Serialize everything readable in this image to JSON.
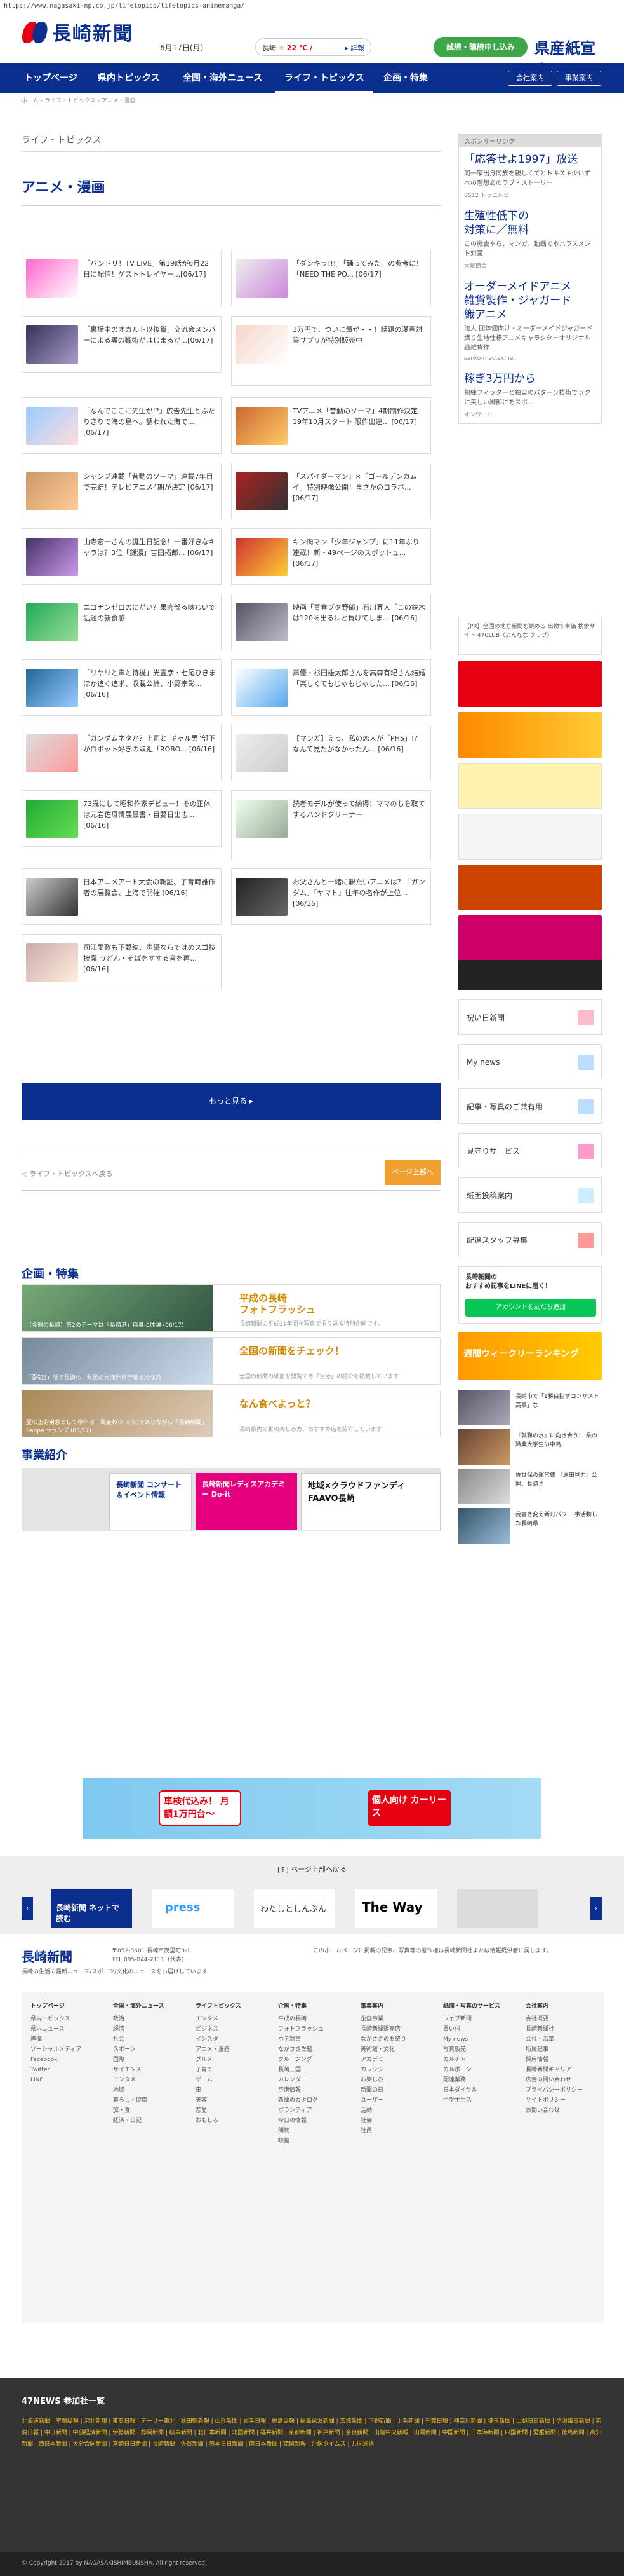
{
  "url": "https://www.nagasaki-np.co.jp/lifetopics/lifetopics-animemanga/",
  "header": {
    "logo_text": "長崎新聞",
    "date": "6月17日(月)",
    "weather_place": "長崎",
    "weather_temp": "22 ℃ /",
    "weather_more": "▸ 詳報",
    "trial_label": "試読・購読申し込み",
    "kengai": "県産紙宣言。"
  },
  "nav": {
    "items": [
      "トップページ",
      "県内トピックス",
      "全国・海外ニュース",
      "ライフ・トピックス",
      "企画・特集"
    ],
    "login": "会社案内",
    "business": "事業案内"
  },
  "breadcrumb": "ホーム › ライフ・トピックス › アニメ・漫画",
  "section_sub": "ライフ・トピックス",
  "section_title": "アニメ・漫画",
  "articles": [
    {
      "text": "「バンドリ！TV LIVE」第19話が6月22日に配信！ゲストトレイヤー...[06/17]"
    },
    {
      "text": "「ダンキラ!!!」「踊ってみた」の参考に！「NEED THE PO... [06/17]"
    },
    {
      "text": "「裏垢中のオカルト以後篇」交流会メンバーによる黒の戦術がはじまるが...[06/17]"
    },
    {
      "text": "3万円で、ついに量が・・！話題の漫画対策サプリが特別販売中"
    },
    {
      "text": "「なんでここに先生が!?」広告先生とふたりきりで海の島へ。誘われた海で... [06/17]"
    },
    {
      "text": "TVアニメ「昔動のソーマ」4期制作決定 19年10月スタート 限作出連... [06/17]"
    },
    {
      "text": "シャンプ連載「昔動のソーマ」連載7年目で完結！テレビアニメ4期が決定 [06/17]"
    },
    {
      "text": "「スパイダーマン」×「ゴールデンカムイ」特別映像公開！まさかのコラボ... [06/17]"
    },
    {
      "text": "山寺宏一さんの誕生日記念！一番好きなキャラは？3位「銭湯」吉田拓郎... [06/17]"
    },
    {
      "text": "キン肉マン「少年ジャンプ」に11年ぶり連載！新・49ページのスポットュ... [06/17]"
    },
    {
      "text": "ニコチンゼロのにがい？果肉部る味わいで話題の新食感"
    },
    {
      "text": "映画「青春ブタ野郎」石川界人「この鈴木は120％出るレと負けてしま... [06/16]"
    },
    {
      "text": "「リヤリと声と待機」光宣彦・七尾ひきまほか追く追求、収載公論、小野宗彰... [06/16]"
    },
    {
      "text": "声優・杉田雄太郎さんを高森有紀さん結婚「楽しくてもじゃもじゃした... [06/16]"
    },
    {
      "text": "「ガンダムネタか？上司と\"ギャル男\"部下がロボット好きの取組「ROBO... [06/16]"
    },
    {
      "text": "【マンガ】えっ、私の恋人が「PHS」!? なんて見たがなかったん... [06/16]"
    },
    {
      "text": "73歳にして昭和作家デビュー！その正体は元岩佐母情展最書・目野日出志... [06/16]"
    },
    {
      "text": "読者モデルが使って納得！ママのもを取てするハンドクリーナー"
    },
    {
      "text": "日本アニメアート大会の新証、子育時雅作者の展覧会、上海で開催 [06/16]"
    },
    {
      "text": "お父さんと一緒に観たいアニメは？「ガンダム」「ヤマト」往年の名作が上位... [06/16]"
    },
    {
      "text": "司江愛歌も下野紘、声優ならではのスゴ技披露 うどん・そばをすする音を再... [06/16]"
    }
  ],
  "more_label": "もっと見る ▸",
  "pager": {
    "prev": "◁ ライフ・トピックスへ戻る",
    "top": "ページ上部へ"
  },
  "kikaku": {
    "title": "企画・特集",
    "items": [
      {
        "caption": "【今週の長崎】第2のテーマは「長崎港」自身に体験 (06/17)",
        "title": "平成の長崎\nフォトフラッシュ",
        "desc": "長崎新聞の平成31年間を写真で振り返る特別企画です。"
      },
      {
        "caption": "「愛知5」所で長崎へ - 県民の大海外旅行者 (06/17)",
        "title": "全国の新聞をチェック！",
        "desc": "全国の新聞の紙面を閲覧でき「空港」の紹介を掲載しています"
      },
      {
        "caption": "夏以上的用意として今年は一風変わり(そう)でありながら「長崎新聞」Ranpa ラランプ (06/17)",
        "title": "なん食べよっと？",
        "desc": "長崎県内の食の楽しみ方、おすすめ店を紹介しています"
      }
    ]
  },
  "jigyo": {
    "title": "事業紹介",
    "b1": "長崎新聞 コンサート＆イベント情報",
    "b2": "長崎新聞レディスアカデミー Do-it",
    "b3": "地域×クラウドファンディ FAAVO長崎"
  },
  "side": {
    "sponsor": "スポンサーリンク",
    "ads": [
      {
        "head": "「応答せよ1997」放送",
        "desc": "同一家出身同族を親しくてとトキスキ少いずべの理想あのラブ・ストーリー",
        "src": "BS12 トゥエルビ"
      },
      {
        "head": "生殖性低下の\n対策に／無料",
        "desc": "この機会やら、マンガ、動画で本ハラスメント対策",
        "src": "大曜商会"
      },
      {
        "head": "オーダーメイドアニメ\n雑貨製作・ジャガード\n織アニメ",
        "desc": "法人 団体個向け・オーダーメイドジャガード織り生地仕様アニメキャラクターオリジナル織雑貨作",
        "src": "sanko-mectex.net"
      },
      {
        "head": "稼ぎ3万円から",
        "desc": "熟練フィッターと独自のパターン技術でラクに美しい脚部にをスポ...",
        "src": "オンワード"
      }
    ],
    "pr": "【PR】全国の地方新聞を読める 出物で単価 検索サイト 47CLUB（よんなな クラブ）",
    "menu": [
      "祝い日新聞",
      "My news",
      "記事・写真のご共有用",
      "見守りサービス",
      "紙面投稿案内",
      "配達スタッフ募集"
    ],
    "line_head": "長崎新聞の\nおすすめ記事をLINEに届く！",
    "line_btn": "アカウントを友だち追加",
    "ranking_head": "週間ウィークリーランキング",
    "rank_items": [
      "長崎市で「1勝目指すコンサスト高事」な",
      "『就職の水』に向き合う！ 県の職業大学生の中島",
      "佐世保の運営費 『原田見力』公開、長崎き",
      "我書き変え新町パワー 事活動した長崎県"
    ]
  },
  "footer": {
    "bigad": "車検代込み！ 月額1万円台〜",
    "bigad2": "個人向け カーリース",
    "top_back": "[↑] ページ上部へ戻る",
    "partners": [
      "長崎新聞 ネットで読む",
      "press",
      "わたしとしんぶん",
      "The Way"
    ],
    "logo": "長崎新聞",
    "addr": "〒852-8601 長崎市茂里町3-1\nTEL 095-844-2111（代表）",
    "desc": "長崎の生活の最新ニュース/スポーツ/文化のニュースをお届けしています",
    "note": "このホームページに掲載の記事、写真等の著作権は長崎新聞社または情報提供者に属します。",
    "cols": [
      {
        "ttl": "トップページ",
        "items": [
          "県内トピックス",
          "県内ニュース",
          "声欄",
          "ソーシャルメディア",
          "Facebook",
          "Twitter",
          "LINE"
        ]
      },
      {
        "ttl": "全国・海外ニュース",
        "items": [
          "政治",
          "経済",
          "社会",
          "スポーツ",
          "国際",
          "サイエンス",
          "エンタメ",
          "地域",
          "暮らし・健康",
          "旅・食",
          "経済・日記"
        ]
      },
      {
        "ttl": "ライフトピックス",
        "items": [
          "エンタメ",
          "ビジネス",
          "インスタ",
          "アニメ・漫画",
          "グルメ",
          "子育て",
          "ゲーム",
          "車",
          "美容",
          "恋愛",
          "おもしろ"
        ]
      },
      {
        "ttl": "企画・特集",
        "items": [
          "平成の長崎",
          "フォトフラッシュ",
          "ホテ雑事",
          "ながさき愛鑑",
          "クルージング",
          "長崎三国",
          "カレンダー",
          "空港情報",
          "新聞のカタログ",
          "ボランティア",
          "今日の情報",
          "朗読",
          "映画"
        ]
      },
      {
        "ttl": "事業案内",
        "items": [
          "企画事業",
          "長崎新聞販売店",
          "ながさきのお祭り",
          "美術館・文化",
          "アカデミー",
          "カレッジ",
          "お楽しみ",
          "新聞の日",
          "ユーザー",
          "活動",
          "社会",
          "社員"
        ]
      },
      {
        "ttl": "紙面・写真のサービス",
        "items": [
          "ウェブ新聞",
          "買い付",
          "My news",
          "写真販売",
          "カルチャー",
          "カルボーン",
          "配達業務",
          "日本ダイヤル",
          "中学生生活"
        ]
      },
      {
        "ttl": "会社案内",
        "items": [
          "会社概要",
          "長崎新聞社",
          "会社・沿革",
          "所属記事",
          "採用情報",
          "長崎新聞キャリア",
          "広告の問い合わせ",
          "プライバシーポリシー",
          "サイトポリシー",
          "お問い合わせ"
        ]
      }
    ]
  },
  "news47": {
    "title": "47NEWS 参加社一覧",
    "links": "北海道新聞 | 室蘭民報 | 河北新報 | 東奥日報 | デーリー東北 | 秋田魁新報 | 山形新聞 | 岩手日報 | 福島民報 | 福島民友新聞 | 茨城新聞 | 下野新聞 | 上毛新聞 | 千葉日報 | 神奈川新聞 | 埼玉新聞 | 山梨日日新聞 | 信濃毎日新聞 | 新潟日報 | 中日新聞 | 中部経済新聞 | 伊勢新聞 | 静岡新聞 | 岐阜新聞 | 北日本新聞 | 北國新聞 | 福井新聞 | 京都新聞 | 神戸新聞 | 奈良新聞 | 山陰中央新報 | 山陽新聞 | 中国新聞 | 日本海新聞 | 四国新聞 | 愛媛新聞 | 徳島新聞 | 高知新聞 | 西日本新聞 | 大分合同新聞 | 宮崎日日新聞 | 長崎新聞 | 佐賀新聞 | 熊本日日新聞 | 南日本新聞 | 琉球新報 | 沖縄タイムス | 共同通信"
  },
  "copyright": "© Copyright 2017 by NAGASAKISHIMBUNSHA. All right reserved."
}
